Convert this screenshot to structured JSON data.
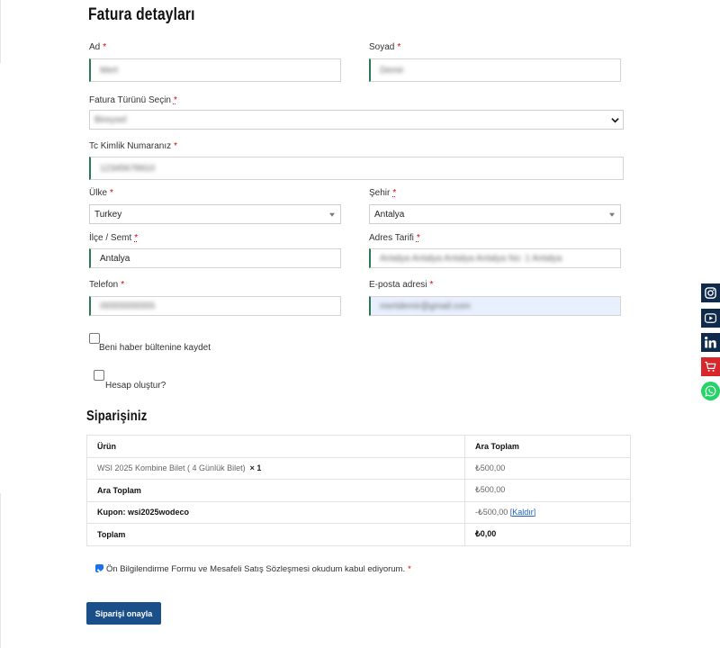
{
  "billing": {
    "title": "Fatura detayları",
    "fields": {
      "ad": {
        "label": "Ad",
        "req": "*",
        "value": "Mert"
      },
      "soyad": {
        "label": "Soyad",
        "req": "*",
        "value": "Demir"
      },
      "fatura_turu": {
        "label": "Fatura Türünü Seçin",
        "req": "*",
        "value": "Bireysel"
      },
      "tc": {
        "label": "Tc Kimlik Numaranız",
        "req": "*",
        "value": "12345678910"
      },
      "ulke": {
        "label": "Ülke",
        "req": "*",
        "value": "Turkey"
      },
      "sehir": {
        "label": "Şehir",
        "req": "*",
        "value": "Antalya"
      },
      "ilce": {
        "label": "İlçe / Semt",
        "req": "*",
        "value": "Antalya"
      },
      "adres": {
        "label": "Adres Tarifi",
        "req": "*",
        "value": "Antalya Antalya Antalya Antalya No: 1 Antalya"
      },
      "telefon": {
        "label": "Telefon",
        "req": "*",
        "value": "05555555555"
      },
      "eposta": {
        "label": "E-posta adresi",
        "req": "*",
        "value": "mertdemir@gmail.com"
      }
    },
    "newsletter_label": "Beni haber bültenine kaydet",
    "create_account_label": "Hesap oluştur?"
  },
  "order": {
    "title": "Siparişiniz",
    "headers": {
      "product": "Ürün",
      "subtotal": "Ara Toplam"
    },
    "item": {
      "name": "WSI 2025 Kombine Bilet ( 4 Günlük Bilet)",
      "qty": "× 1",
      "price": "₺500,00"
    },
    "subtotal": {
      "label": "Ara Toplam",
      "value": "₺500,00"
    },
    "coupon": {
      "label": "Kupon: wsi2025wodeco",
      "value": "-₺500,00",
      "remove": "[Kaldır]"
    },
    "total": {
      "label": "Toplam",
      "value": "₺0,00"
    }
  },
  "terms": {
    "label": "Ön Bilgilendirme Formu ve Mesafeli Satış Sözleşmesi okudum kabul ediyorum.",
    "req": "*"
  },
  "submit_label": "Siparişi onayla",
  "colors": {
    "accent": "#2b7a55",
    "button": "#1b4f8a",
    "instagram": "#0f2a4a",
    "youtube": "#0f2a4a",
    "linkedin": "#0f2a4a",
    "cart": "#d7262c",
    "whatsapp": "#25d366"
  },
  "social_icons": [
    "instagram-icon",
    "youtube-icon",
    "linkedin-icon",
    "cart-icon",
    "whatsapp-icon"
  ]
}
